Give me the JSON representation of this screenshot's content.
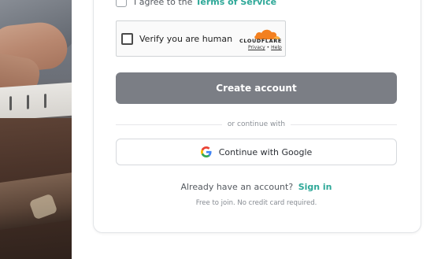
{
  "signup": {
    "terms_prefix": "I agree to the",
    "terms_link": "Terms of Service",
    "captcha": {
      "label": "Verify you are human",
      "brand": "CLOUDFLARE",
      "privacy": "Privacy",
      "separator": "•",
      "help": "Help"
    },
    "create_button": "Create account",
    "divider_text": "or continue with",
    "google_button": "Continue with Google",
    "signin_prompt": "Already have an account?",
    "signin_link": "Sign in",
    "footnote": "Free to join. No credit card required."
  },
  "colors": {
    "accent": "#2ea898",
    "primary_button": "#7b7e85",
    "cloudflare_orange": "#f38020"
  },
  "icons": {
    "google": "google-g-icon",
    "cloudflare": "cloudflare-cloud-icon"
  }
}
